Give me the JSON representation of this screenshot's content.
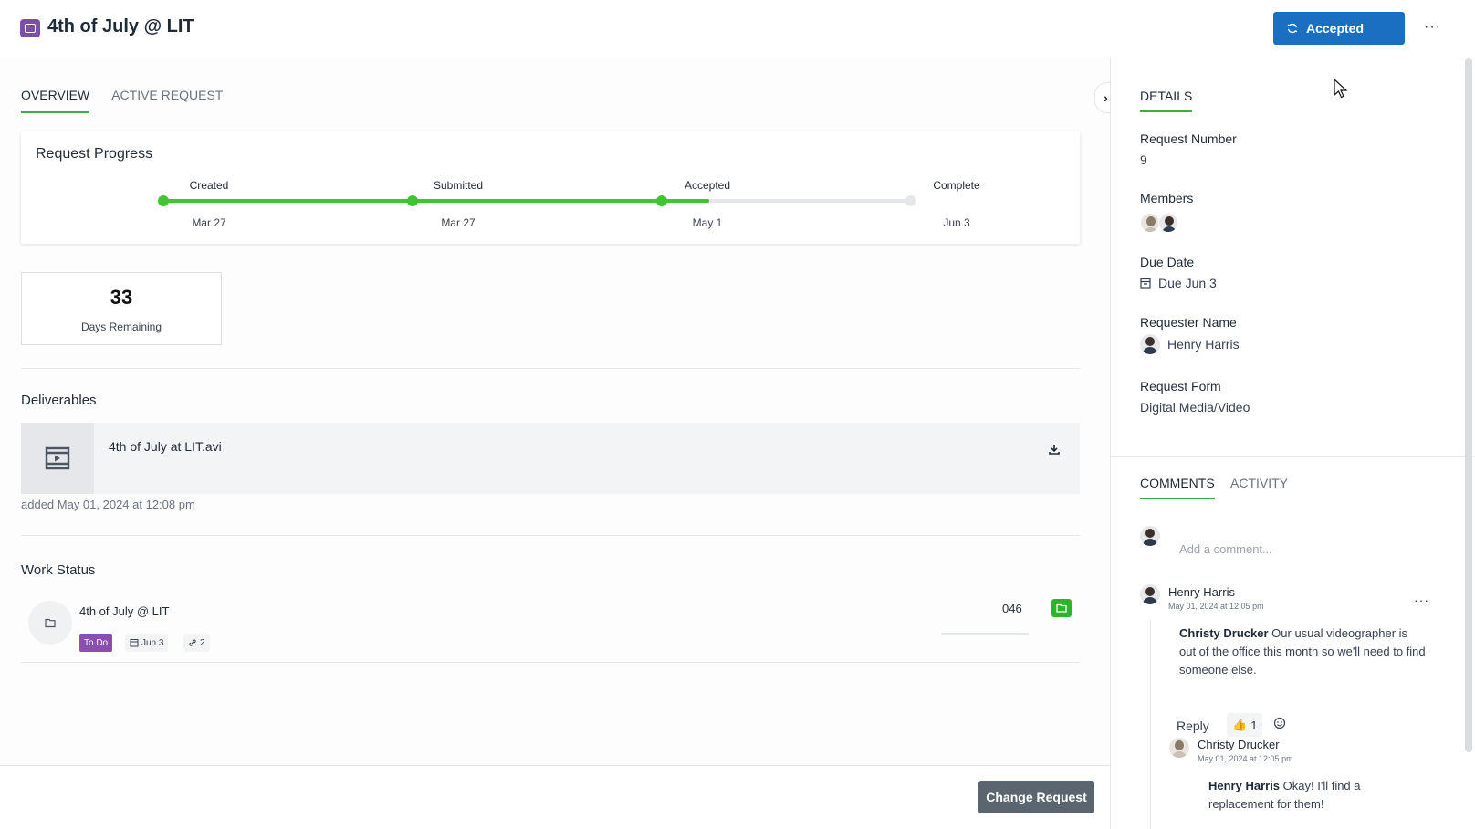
{
  "header": {
    "title": "4th of July @ LIT",
    "status_label": "Accepted",
    "more_label": "···"
  },
  "tabs": [
    {
      "label": "OVERVIEW",
      "active": true
    },
    {
      "label": "ACTIVE REQUEST",
      "active": false
    }
  ],
  "progress": {
    "title": "Request Progress",
    "fraction_complete": 0.73,
    "steps": [
      {
        "label": "Created",
        "date": "Mar 27",
        "done": true
      },
      {
        "label": "Submitted",
        "date": "Mar 27",
        "done": true
      },
      {
        "label": "Accepted",
        "date": "May 1",
        "done": true
      },
      {
        "label": "Complete",
        "date": "Jun 3",
        "done": false
      }
    ]
  },
  "days_remaining": {
    "value": "33",
    "label": "Days Remaining"
  },
  "deliverables": {
    "heading": "Deliverables",
    "items": [
      {
        "name": "4th of July at LIT.avi",
        "meta": "added May 01, 2024 at 12:08 pm"
      }
    ]
  },
  "work_status": {
    "heading": "Work Status",
    "title": "4th of July @ LIT",
    "status_chip": "To Do",
    "due_chip": "Jun 3",
    "link_count": "2",
    "code": "046",
    "progress_fraction": 0.0
  },
  "footer": {
    "change_label": "Change Request"
  },
  "details": {
    "tab": "DETAILS",
    "request_number_label": "Request Number",
    "request_number": "9",
    "members_label": "Members",
    "due_date_label": "Due Date",
    "due_date": "Due Jun 3",
    "requester_label": "Requester Name",
    "requester": "Henry Harris",
    "form_label": "Request Form",
    "form": "Digital Media/Video"
  },
  "comments": {
    "tabs": [
      {
        "label": "COMMENTS",
        "active": true
      },
      {
        "label": "ACTIVITY",
        "active": false
      }
    ],
    "placeholder": "Add a comment...",
    "thread": {
      "author": "Henry Harris",
      "time": "May 01, 2024 at 12:05 pm",
      "mention": "Christy Drucker",
      "text": " Our usual videographer is out of the office this month so we'll need to find someone else.",
      "reply_label": "Reply",
      "reaction_emoji": "👍",
      "reaction_count": "1"
    },
    "reply": {
      "author": "Christy Drucker",
      "time": "May 01, 2024 at 12:05 pm",
      "mention": "Henry Harris",
      "text": " Okay! I'll find a replacement for them!"
    }
  },
  "colors": {
    "accent": "#3cb043",
    "status_blue": "#1a6fc0",
    "todo_purple": "#8a4fb0",
    "progress_green": "#3ec530"
  }
}
